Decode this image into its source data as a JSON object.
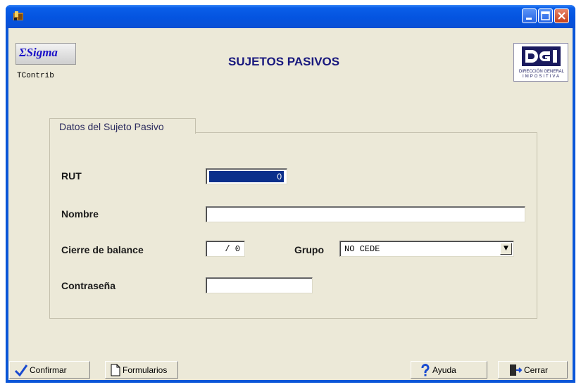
{
  "header": {
    "brand": "ΣSigma",
    "form_code": "TContrib",
    "title": "SUJETOS PASIVOS",
    "dgi_logo": {
      "letters": "DGI",
      "line1": "DIRECCIÓN GENERAL",
      "line2": "IMPOSITIVA"
    }
  },
  "group": {
    "title": "Datos del Sujeto Pasivo"
  },
  "fields": {
    "rut": {
      "label": "RUT",
      "value": "0"
    },
    "nombre": {
      "label": "Nombre",
      "value": ""
    },
    "cierre": {
      "label": "Cierre de balance",
      "value": "/ 0"
    },
    "grupo": {
      "label": "Grupo",
      "value": "NO CEDE"
    },
    "contrasena": {
      "label": "Contraseña",
      "value": ""
    }
  },
  "buttons": {
    "confirmar": "Confirmar",
    "formularios": "Formularios",
    "ayuda": "Ayuda",
    "cerrar": "Cerrar"
  },
  "icons": [
    "app-icon",
    "minimize-icon",
    "maximize-icon",
    "close-icon",
    "check-icon",
    "document-icon",
    "help-icon",
    "exit-door-icon",
    "chevron-down-icon"
  ],
  "colors": {
    "titlebar": "#0454e0",
    "title_text": "#19197e",
    "selection": "#0b2f8b",
    "face": "#ece9d8"
  }
}
